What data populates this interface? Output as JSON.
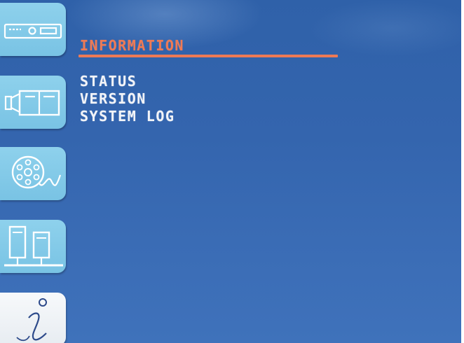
{
  "sidebar": {
    "items": [
      {
        "icon": "dvr-recorder-icon",
        "active": false
      },
      {
        "icon": "camera-icon",
        "active": false
      },
      {
        "icon": "disk-icon",
        "active": false
      },
      {
        "icon": "network-icon",
        "active": false
      },
      {
        "icon": "info-icon",
        "active": true
      }
    ]
  },
  "main": {
    "title": "INFORMATION",
    "menu": [
      "STATUS",
      "VERSION",
      "SYSTEM LOG"
    ]
  },
  "colors": {
    "background": "#3465ae",
    "sidebar_button": "#8ed1ec",
    "sidebar_button_active": "#f3f6f9",
    "title_accent": "#ee7a55",
    "menu_text": "#f2f4f8"
  }
}
